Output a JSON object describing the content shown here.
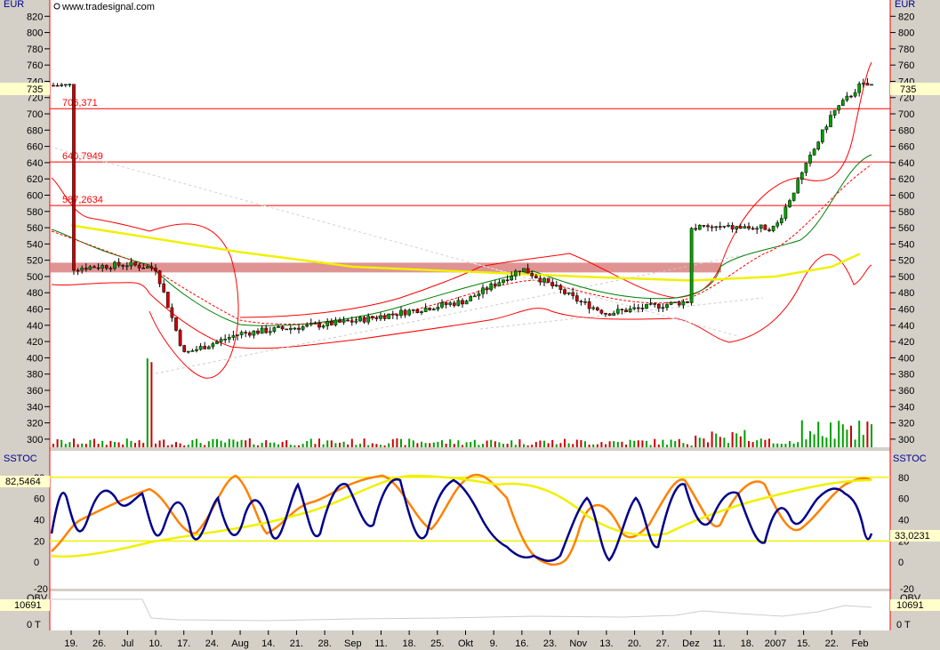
{
  "watermark": "www.tradesignal.com",
  "colors": {
    "background": "#ffffff",
    "frame": "#d4d0c8",
    "accent_red": "#ff0000",
    "up_candle": "#00a000",
    "down_candle": "#cc0000",
    "sma_yellow": "#f0f000",
    "stoch_orange": "#ff8000",
    "stoch_navy": "#00008b",
    "obv_line": "#ffffff",
    "resistance_zone": "#d98080"
  },
  "price_panel": {
    "unit": "EUR",
    "ylim": [
      290,
      840
    ],
    "ticks": [
      300,
      320,
      340,
      360,
      380,
      400,
      420,
      440,
      460,
      480,
      500,
      520,
      540,
      560,
      580,
      600,
      620,
      640,
      660,
      680,
      700,
      720,
      740,
      760,
      780,
      800,
      820
    ],
    "last_price": "735",
    "levels": [
      {
        "label": "706,371",
        "value": 706.371
      },
      {
        "label": "640,7949",
        "value": 640.7949
      },
      {
        "label": "587,2634",
        "value": 587.2634
      }
    ],
    "zone": [
      505,
      517
    ]
  },
  "stoch_panel": {
    "title": "SSTOC",
    "ylim": [
      -25,
      105
    ],
    "ticks": [
      0,
      20,
      40,
      60,
      80
    ],
    "lower_tick": "-20",
    "marker_left": "82,5464",
    "marker_right": "33,0231",
    "bands": [
      20,
      80
    ]
  },
  "obv_panel": {
    "title": "OBV",
    "left_value": "10691",
    "right_value": "10691",
    "zero_label": "0 T"
  },
  "x_axis": {
    "labels": [
      "19.",
      "26.",
      "Jul",
      "10.",
      "17.",
      "24.",
      "Aug",
      "14.",
      "21.",
      "28.",
      "Sep",
      "11.",
      "18.",
      "25.",
      "Okt",
      "9.",
      "16.",
      "23.",
      "Nov",
      "13.",
      "20.",
      "27.",
      "Dez",
      "11.",
      "18.",
      "2007",
      "15.",
      "22.",
      "Feb"
    ]
  },
  "chart_data": {
    "type": "candlestick",
    "key_points": [
      {
        "date": "19.",
        "price": 510
      },
      {
        "date": "Jul",
        "price": 515
      },
      {
        "date": "10.",
        "price": 510
      },
      {
        "date": "17.",
        "price": 405
      },
      {
        "date": "Aug",
        "price": 430
      },
      {
        "date": "Sep",
        "price": 445
      },
      {
        "date": "Okt",
        "price": 470
      },
      {
        "date": "16.",
        "price": 510
      },
      {
        "date": "Nov",
        "price": 470
      },
      {
        "date": "13.",
        "price": 455
      },
      {
        "date": "Dez",
        "price": 470
      },
      {
        "date": "18.",
        "price": 560
      },
      {
        "date": "2007",
        "price": 560
      },
      {
        "date": "22.",
        "price": 700
      },
      {
        "date": "Feb",
        "price": 735
      }
    ],
    "sma_points": [
      {
        "date": "19.",
        "price": 563
      },
      {
        "date": "Aug",
        "price": 530
      },
      {
        "date": "Sep",
        "price": 512
      },
      {
        "date": "Nov",
        "price": 500
      },
      {
        "date": "Dez",
        "price": 495
      },
      {
        "date": "2007",
        "price": 500
      },
      {
        "date": "22.",
        "price": 512
      },
      {
        "date": "Feb",
        "price": 528
      }
    ]
  }
}
